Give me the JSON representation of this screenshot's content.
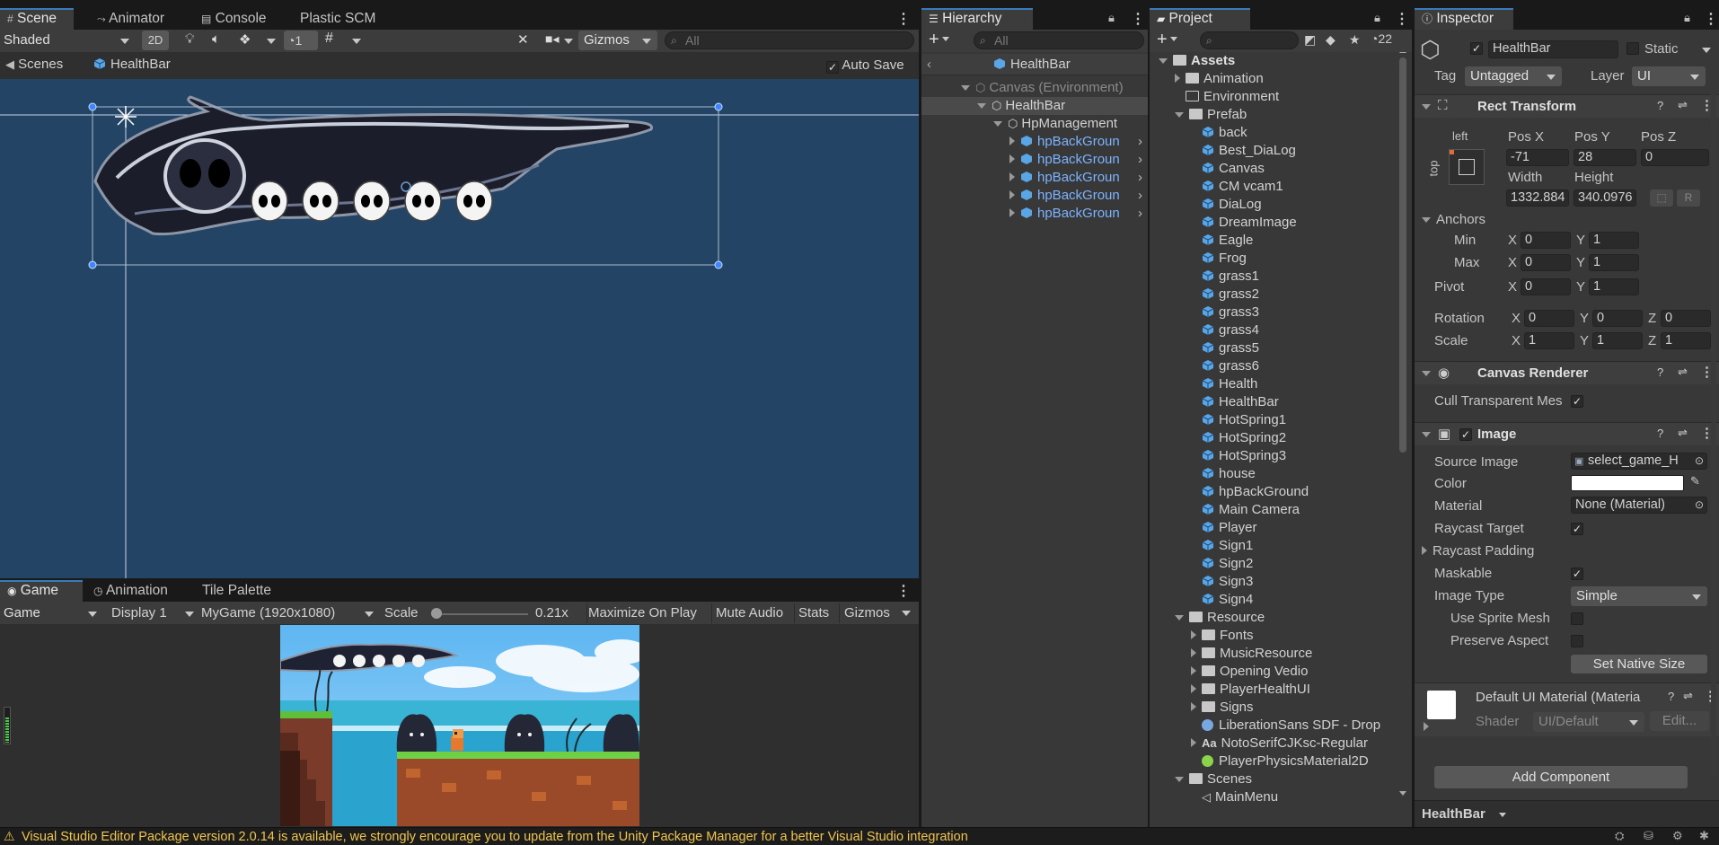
{
  "scene_tabs": {
    "scene": "Scene",
    "animator": "Animator",
    "console": "Console",
    "plastic": "Plastic SCM"
  },
  "scene_toolbar": {
    "shading": "Shaded",
    "mode_2d": "2D",
    "visibility_count": "1",
    "gizmos": "Gizmos",
    "search_placeholder": "All"
  },
  "scene_breadcrumb": {
    "scenes": "Scenes",
    "prefab": "HealthBar",
    "auto_save": "Auto Save"
  },
  "game_tabs": {
    "game": "Game",
    "animation": "Animation",
    "tile_palette": "Tile Palette"
  },
  "game_toolbar": {
    "view": "Game",
    "display": "Display 1",
    "resolution": "MyGame (1920x1080)",
    "scale_label": "Scale",
    "scale_value": "0.21x",
    "maximize": "Maximize On Play",
    "mute": "Mute Audio",
    "stats": "Stats",
    "gizmos": "Gizmos"
  },
  "hierarchy": {
    "tab": "Hierarchy",
    "search_placeholder": "All",
    "root": "HealthBar",
    "items": [
      "Canvas (Environment)",
      "HealthBar",
      "HpManagement",
      "hpBackGroun",
      "hpBackGroun",
      "hpBackGroun",
      "hpBackGroun",
      "hpBackGroun"
    ]
  },
  "project": {
    "tab": "Project",
    "hidden_count": "22",
    "assets": "Assets",
    "folders_top": [
      "Animation",
      "Environment"
    ],
    "prefab_folder": "Prefab",
    "prefabs": [
      "back",
      "Best_DiaLog",
      "Canvas",
      "CM vcam1",
      "DiaLog",
      "DreamImage",
      "Eagle",
      "Frog",
      "grass1",
      "grass2",
      "grass3",
      "grass4",
      "grass5",
      "grass6",
      "Health",
      "HealthBar",
      "HotSpring1",
      "HotSpring2",
      "HotSpring3",
      "house",
      "hpBackGround",
      "Main Camera",
      "Player",
      "Sign1",
      "Sign2",
      "Sign3",
      "Sign4"
    ],
    "resource_folder": "Resource",
    "resource_items": [
      "Fonts",
      "MusicResource",
      "Opening Vedio",
      "PlayerHealthUI",
      "Signs"
    ],
    "font_asset": "LiberationSans SDF - Drop",
    "font_file": "NotoSerifCJKsc-Regular",
    "physics_material": "PlayerPhysicsMaterial2D",
    "scenes_folder": "Scenes",
    "main_menu": "MainMenu"
  },
  "inspector": {
    "tab": "Inspector",
    "object_name": "HealthBar",
    "static_label": "Static",
    "tag_label": "Tag",
    "tag_value": "Untagged",
    "layer_label": "Layer",
    "layer_value": "UI",
    "rect_transform": {
      "title": "Rect Transform",
      "anchor_h": "left",
      "anchor_v": "top",
      "pos_x_label": "Pos X",
      "pos_y_label": "Pos Y",
      "pos_z_label": "Pos Z",
      "pos_x": "-71",
      "pos_y": "28",
      "pos_z": "0",
      "width_label": "Width",
      "height_label": "Height",
      "width": "1332.884",
      "height": "340.0976",
      "r_button": "R",
      "anchors_label": "Anchors",
      "min_label": "Min",
      "min_x": "0",
      "min_y": "1",
      "max_label": "Max",
      "max_x": "0",
      "max_y": "1",
      "pivot_label": "Pivot",
      "pivot_x": "0",
      "pivot_y": "1",
      "rotation_label": "Rotation",
      "rot_x": "0",
      "rot_y": "0",
      "rot_z": "0",
      "scale_label": "Scale",
      "scale_x": "1",
      "scale_y": "1",
      "scale_z": "1",
      "axis_x": "X",
      "axis_y": "Y",
      "axis_z": "Z"
    },
    "canvas_renderer": {
      "title": "Canvas Renderer",
      "cull_label": "Cull Transparent Mes"
    },
    "image": {
      "title": "Image",
      "source_label": "Source Image",
      "source_value": "select_game_H",
      "color_label": "Color",
      "material_label": "Material",
      "material_value": "None (Material)",
      "raycast_target_label": "Raycast Target",
      "raycast_padding_label": "Raycast Padding",
      "maskable_label": "Maskable",
      "image_type_label": "Image Type",
      "image_type_value": "Simple",
      "use_sprite_mesh_label": "Use Sprite Mesh",
      "preserve_aspect_label": "Preserve Aspect",
      "set_native_size": "Set Native Size"
    },
    "material_preview": {
      "title": "Default UI Material (Materia",
      "shader_label": "Shader",
      "shader_value": "UI/Default",
      "edit": "Edit..."
    },
    "add_component": "Add Component",
    "footer_label": "HealthBar"
  },
  "status_bar": {
    "message": "Visual Studio Editor Package version 2.0.14 is available, we strongly encourage you to update from the Unity Package Manager for a better Visual Studio integration"
  },
  "colors": {
    "accent": "#3a79bb",
    "scene_bg": "#244466",
    "prefab_blue": "#7cb3ff",
    "warning": "#f0c54a"
  }
}
